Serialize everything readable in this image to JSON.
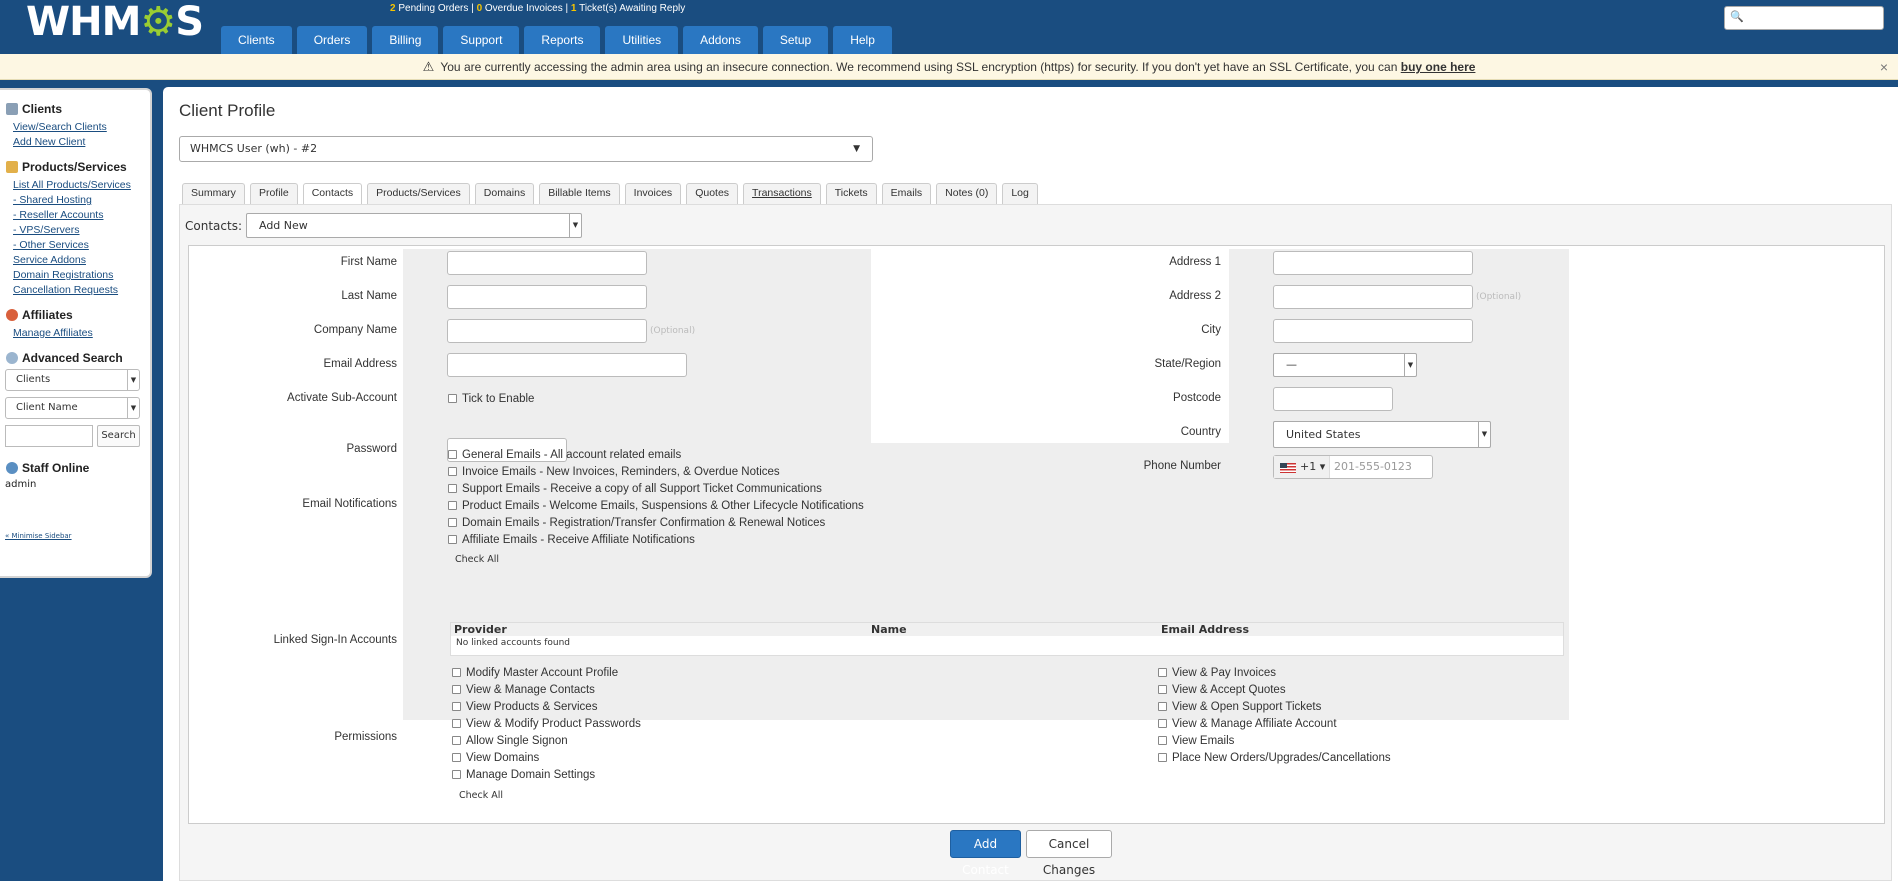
{
  "header": {
    "logo": "WHMCS",
    "stats": {
      "pending_orders_count": "2",
      "pending_orders_label": "Pending Orders",
      "overdue_invoices_count": "0",
      "overdue_invoices_label": "Overdue Invoices",
      "tickets_count": "1",
      "tickets_label": "Ticket(s) Awaiting Reply",
      "separator": "|"
    },
    "nav": [
      "Clients",
      "Orders",
      "Billing",
      "Support",
      "Reports",
      "Utilities",
      "Addons",
      "Setup",
      "Help"
    ],
    "search_icon": "magnifier-icon"
  },
  "warning": {
    "text": "You are currently accessing the admin area using an insecure connection. We recommend using SSL encryption (https) for security. If you don't yet have an SSL Certificate, you can",
    "link": "buy one here",
    "close": "×",
    "icon": "⚠"
  },
  "sidebar": {
    "clients_heading": "Clients",
    "clients_links": [
      "View/Search Clients",
      "Add New Client"
    ],
    "products_heading": "Products/Services",
    "products_links": [
      "List All Products/Services",
      "- Shared Hosting",
      "- Reseller Accounts",
      "- VPS/Servers",
      "- Other Services",
      "Service Addons",
      "Domain Registrations",
      "Cancellation Requests"
    ],
    "affiliates_heading": "Affiliates",
    "affiliates_links": [
      "Manage Affiliates"
    ],
    "advanced_search_heading": "Advanced Search",
    "adv_select1": "Clients",
    "adv_select2": "Client Name",
    "search_button": "Search",
    "staff_heading": "Staff Online",
    "staff_name": "admin",
    "minimise": "« Minimise Sidebar"
  },
  "main": {
    "title": "Client Profile",
    "client_select": "WHMCS User (wh) - #2",
    "tabs": [
      "Summary",
      "Profile",
      "Contacts",
      "Products/Services",
      "Domains",
      "Billable Items",
      "Invoices",
      "Quotes",
      "Transactions",
      "Tickets",
      "Emails",
      "Notes (0)",
      "Log"
    ],
    "active_tab": "Contacts",
    "contacts_label": "Contacts:",
    "contacts_select": "Add New"
  },
  "form": {
    "first_name": "First Name",
    "last_name": "Last Name",
    "company_name": "Company Name",
    "email_address": "Email Address",
    "activate_sub": "Activate Sub-Account",
    "tick_to_enable": "Tick to Enable",
    "password": "Password",
    "optional": "(Optional)",
    "address1": "Address 1",
    "address2": "Address 2",
    "city": "City",
    "state": "State/Region",
    "state_value": "—",
    "postcode": "Postcode",
    "country": "Country",
    "country_value": "United States",
    "phone": "Phone Number",
    "phone_code": "+1 ▾",
    "phone_placeholder": "201-555-0123",
    "email_notifications": "Email Notifications",
    "notifications": [
      "General Emails - All account related emails",
      "Invoice Emails - New Invoices, Reminders, & Overdue Notices",
      "Support Emails - Receive a copy of all Support Ticket Communications",
      "Product Emails - Welcome Emails, Suspensions & Other Lifecycle Notifications",
      "Domain Emails - Registration/Transfer Confirmation & Renewal Notices",
      "Affiliate Emails - Receive Affiliate Notifications"
    ],
    "check_all": "Check All",
    "linked_accounts": "Linked Sign-In Accounts",
    "linked_headers": [
      "Provider",
      "Name",
      "Email Address"
    ],
    "linked_empty": "No linked accounts found",
    "permissions": "Permissions",
    "permissions_left": [
      "Modify Master Account Profile",
      "View & Manage Contacts",
      "View Products & Services",
      "View & Modify Product Passwords",
      "Allow Single Signon",
      "View Domains",
      "Manage Domain Settings"
    ],
    "permissions_right": [
      "View & Pay Invoices",
      "View & Accept Quotes",
      "View & Open Support Tickets",
      "View & Manage Affiliate Account",
      "View Emails",
      "Place New Orders/Upgrades/Cancellations"
    ],
    "add_contact": "Add Contact",
    "cancel_changes": "Cancel Changes"
  }
}
